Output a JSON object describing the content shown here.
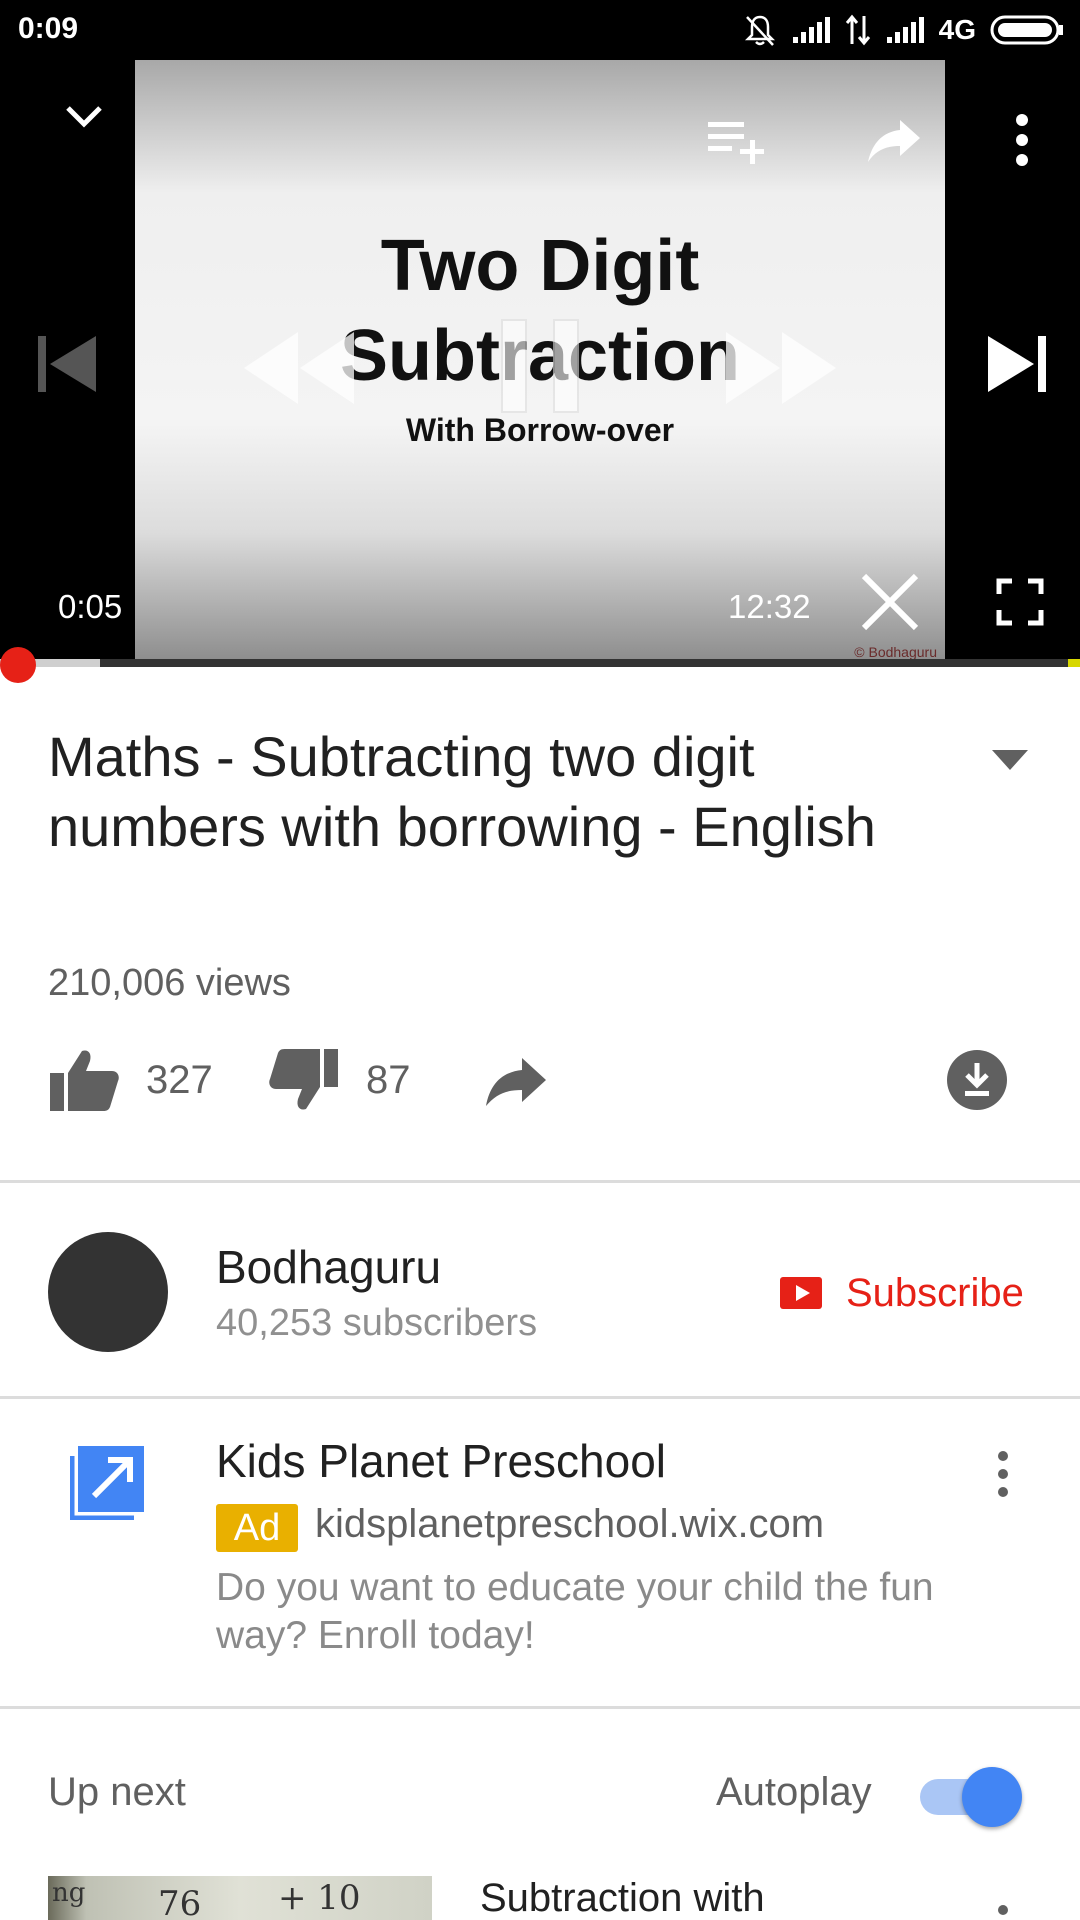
{
  "status_bar": {
    "time": "0:09",
    "network": "4G",
    "icons": [
      "notifications-off-icon",
      "signal-icon",
      "data-arrows-icon",
      "signal-icon",
      "battery-icon"
    ]
  },
  "player": {
    "video_title_line1": "Two Digit",
    "video_title_line2": "Subtraction",
    "video_title_line3": "With Borrow-over",
    "watermark": "© Bodhaguru",
    "current_time": "0:05",
    "duration": "12:32",
    "icons": [
      "chevron-down-icon",
      "add-to-playlist-icon",
      "share-icon",
      "more-vert-icon",
      "previous-icon",
      "rewind-icon",
      "pause-icon",
      "fast-forward-icon",
      "next-icon",
      "close-icon",
      "fullscreen-icon"
    ]
  },
  "video": {
    "title": "Maths - Subtracting two digit numbers with borrowing - English",
    "views": "210,006 views",
    "likes": "327",
    "dislikes": "87"
  },
  "channel": {
    "name": "Bodhaguru",
    "subscribers": "40,253 subscribers",
    "subscribe_label": "Subscribe"
  },
  "ad": {
    "title": "Kids Planet Preschool",
    "badge": "Ad",
    "url": "kidsplanetpreschool.wix.com",
    "description": "Do you want to educate your child the fun way? Enroll today!"
  },
  "up_next": {
    "label": "Up next",
    "autoplay_label": "Autoplay",
    "autoplay_on": true,
    "next_video_title": "Subtraction with",
    "thumb_text_1": "ng",
    "thumb_text_2": "76",
    "thumb_text_3": "+ 10"
  },
  "colors": {
    "accent_red": "#e62117",
    "autoplay_blue": "#4285f4",
    "ad_badge": "#e9b000"
  }
}
